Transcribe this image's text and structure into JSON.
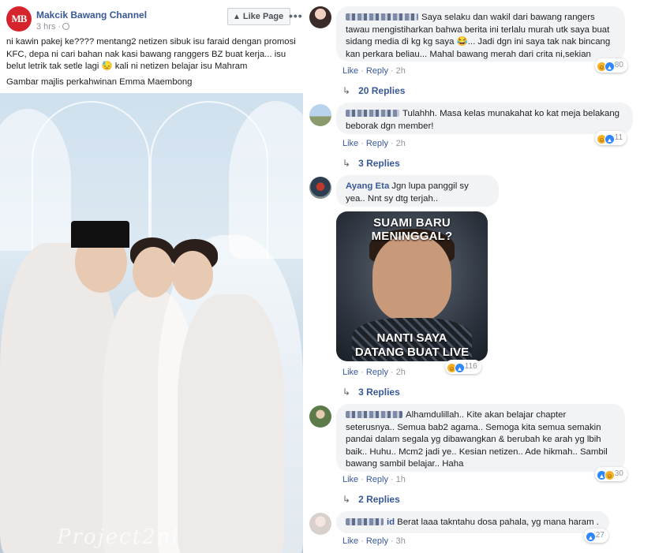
{
  "post": {
    "logo_text": "MB",
    "page_name": "Makcik Bawang Channel",
    "time": "3 hrs ·",
    "like_page_label": "Like Page",
    "more_label": "•••",
    "text": "ni kawin pakej ke???? mentang2 netizen sibuk isu faraid dengan promosi KFC, depa ni cari bahan nak kasi bawang ranggers BZ buat kerja... isu belut letrik tak setle lagi 😓 kali ni netizen belajar isu Mahram",
    "caption": "Gambar majlis perkahwinan Emma Maembong",
    "photo_watermark": "Project2ni"
  },
  "comments": [
    {
      "author": "",
      "text": "Saya selaku dan wakil dari bawang rangers tawau mengistiharkan bahwa berita ini terlalu murah utk saya buat sidang media di kg kg saya 😂... Jadi dgn ini saya tak nak bincang kan perkara beliau... Mahal bawang merah dari crita ni,sekian",
      "like": "Like",
      "reply": "Reply",
      "time": "2h",
      "reactions": "80",
      "replies": "20 Replies"
    },
    {
      "author": "",
      "text": "Tulahhh. Masa kelas munakahat ko kat meja belakang beborak dgn member!",
      "like": "Like",
      "reply": "Reply",
      "time": "2h",
      "reactions": "11",
      "replies": "3 Replies"
    },
    {
      "author": "Ayang Eta",
      "text": "Jgn lupa panggil sy yea.. Nnt sy dtg terjah..",
      "like": "Like",
      "reply": "Reply",
      "time": "2h",
      "reactions": "116",
      "replies": "3 Replies",
      "meme_top": "SUAMI BARU MENINGGAL?",
      "meme_bottom_1": "NANTI SAYA",
      "meme_bottom_2": "DATANG BUAT LIVE"
    },
    {
      "author": "Jason Syda",
      "text": "Alhamdulillah.. Kite akan belajar chapter seterusnya.. Semua bab2 agama.. Semoga kita semua semakin pandai dalam segala yg dibawangkan & berubah ke arah yg lbih baik.. Huhu.. Mcm2 jadi ye.. Kesian netizen.. Ade hikmah.. Sambil bawang sambil belajar.. Haha",
      "like": "Like",
      "reply": "Reply",
      "time": "1h",
      "reactions": "30",
      "replies": "2 Replies"
    },
    {
      "author": "id",
      "text": "Berat laaa takntahu dosa pahala, yg mana haram .",
      "like": "Like",
      "reply": "Reply",
      "time": "3h",
      "reactions": "27"
    }
  ],
  "colors": {
    "link_blue": "#385898",
    "bubble_bg": "#f2f3f5",
    "meta_grey": "#90949c",
    "logo_red": "#d6242d",
    "like_blue": "#2d88ff",
    "haha_yellow": "#f7b125"
  },
  "icons": {
    "more": "more-dots-icon",
    "like_page": "thumb-up-icon",
    "reply_arrow": "reply-arrow-icon",
    "haha": "haha-reaction-icon",
    "like": "like-reaction-icon"
  }
}
